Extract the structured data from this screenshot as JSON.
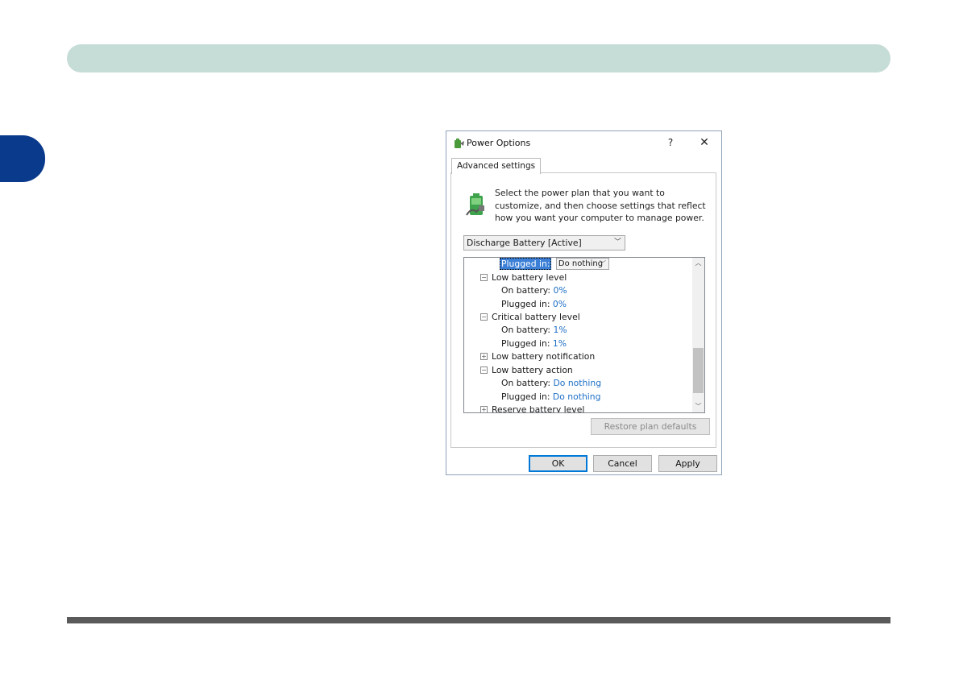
{
  "page": {
    "accent_band_color": "#c6dcd6",
    "side_tab_color": "#0a3a8c"
  },
  "dialog": {
    "title": "Power Options",
    "title_icon": "power-options-icon",
    "help_label": "?",
    "close_label": "✕",
    "tab_label": "Advanced settings",
    "description": "Select the power plan that you want to customize, and then choose settings that reflect how you want your computer to manage power.",
    "plan_select": {
      "value": "Discharge Battery [Active]"
    },
    "tree": {
      "row0": {
        "label": "Plugged in:",
        "value": "Do nothing"
      },
      "low_battery_level": {
        "label": "Low battery level",
        "on_battery_label": "On battery:",
        "on_battery_value": "0%",
        "plugged_in_label": "Plugged in:",
        "plugged_in_value": "0%"
      },
      "critical_battery_level": {
        "label": "Critical battery level",
        "on_battery_label": "On battery:",
        "on_battery_value": "1%",
        "plugged_in_label": "Plugged in:",
        "plugged_in_value": "1%"
      },
      "low_battery_notification": {
        "label": "Low battery notification"
      },
      "low_battery_action": {
        "label": "Low battery action",
        "on_battery_label": "On battery:",
        "on_battery_value": "Do nothing",
        "plugged_in_label": "Plugged in:",
        "plugged_in_value": "Do nothing"
      },
      "reserve_battery_level": {
        "label": "Reserve battery level"
      }
    },
    "restore_label": "Restore plan defaults",
    "ok_label": "OK",
    "cancel_label": "Cancel",
    "apply_label": "Apply"
  }
}
